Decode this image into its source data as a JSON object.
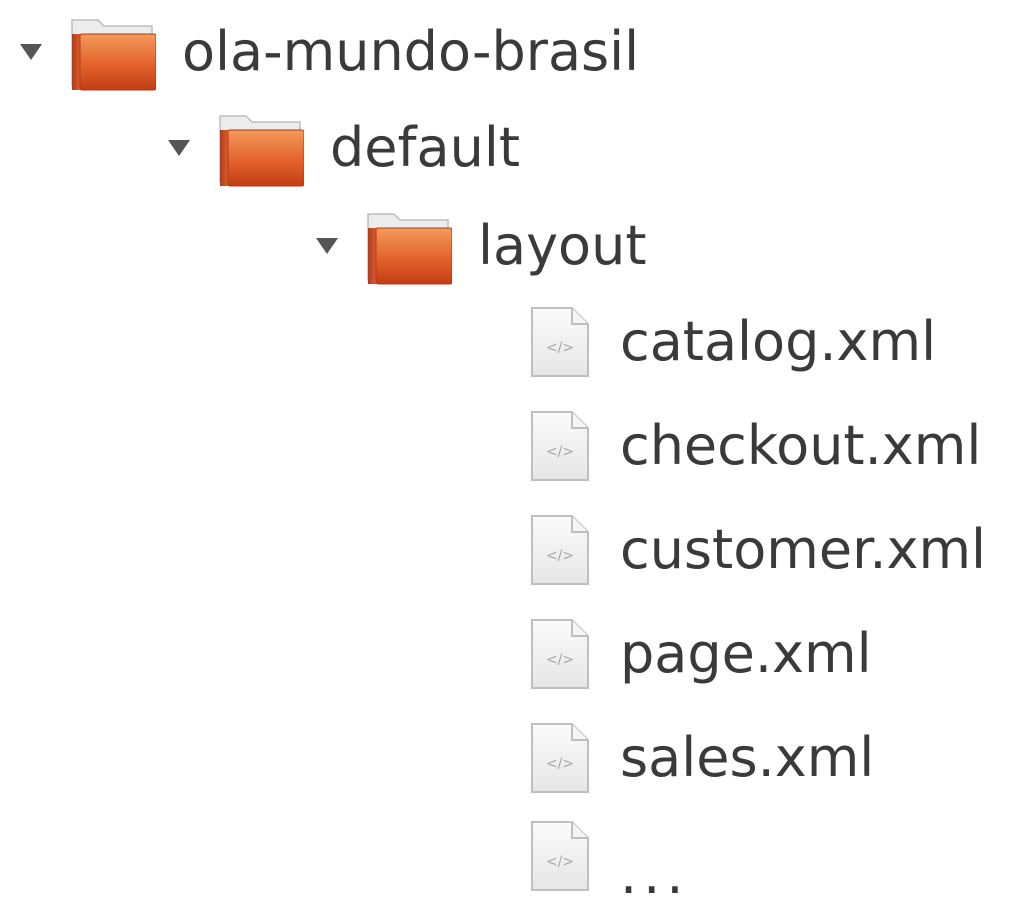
{
  "tree": {
    "root": {
      "label": "ola-mundo-brasil",
      "icon": "folder-icon",
      "expanded": true
    },
    "child": {
      "label": "default",
      "icon": "folder-icon",
      "expanded": true
    },
    "grandchild": {
      "label": "layout",
      "icon": "folder-icon",
      "expanded": true
    },
    "files": [
      {
        "label": "catalog.xml",
        "icon": "xml-file-icon"
      },
      {
        "label": "checkout.xml",
        "icon": "xml-file-icon"
      },
      {
        "label": "customer.xml",
        "icon": "xml-file-icon"
      },
      {
        "label": "page.xml",
        "icon": "xml-file-icon"
      },
      {
        "label": "sales.xml",
        "icon": "xml-file-icon"
      },
      {
        "label": "...",
        "icon": "xml-file-icon"
      }
    ]
  },
  "colors": {
    "folder_dark": "#c8401a",
    "folder_light": "#f0844a",
    "text": "#3a3a3a",
    "expander": "#555555"
  }
}
